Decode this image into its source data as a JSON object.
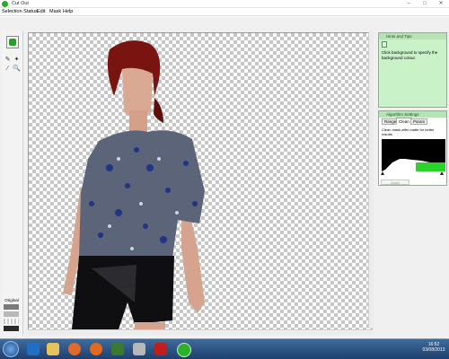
{
  "window": {
    "title": "Cut Out"
  },
  "menu": [
    "Selection Status",
    "Edit",
    "Mask",
    "Help"
  ],
  "left_toolbar": {
    "status_label": "Original"
  },
  "hints_panel": {
    "title": "Hints and Tips",
    "text": "Click background to specify the background colour."
  },
  "algorithm_panel": {
    "title": "Algorithm Settings",
    "tabs": [
      "Range",
      "Clean",
      "Param"
    ],
    "active_tab": "Clean",
    "description": "Clean mask after matte for better results.",
    "button_label": "Apply"
  },
  "clock": {
    "time": "16:52",
    "date": "03/08/2013"
  },
  "colors": {
    "panel_header": "#b6e3b6",
    "panel_body": "#c9f2c9",
    "taskbar": "#274b7a"
  }
}
